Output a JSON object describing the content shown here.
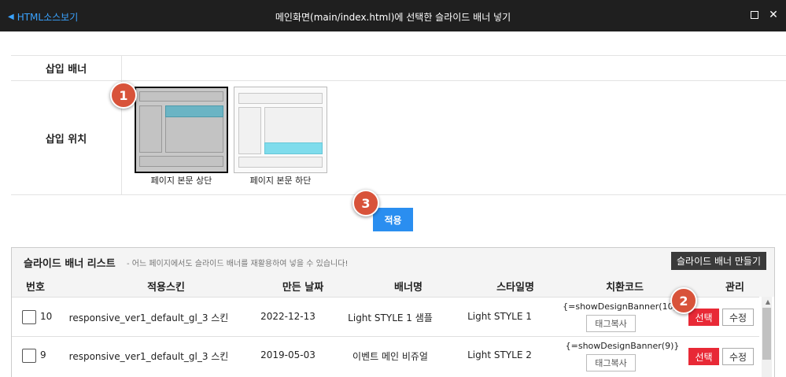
{
  "window": {
    "back_label": "HTML소스보기",
    "title": "메인화면(main/index.html)에 선택한 슬라이드 배너 넣기"
  },
  "options": {
    "banner_label": "삽입 배너",
    "position_label": "삽입 위치",
    "positions": [
      {
        "caption": "페이지 본문 상단",
        "selected": true
      },
      {
        "caption": "페이지 본문 하단",
        "selected": false
      }
    ]
  },
  "badges": [
    "1",
    "2",
    "3"
  ],
  "apply_label": "적용",
  "list": {
    "title": "슬라이드 배너 리스트",
    "description": "- 어느 페이지에서도 슬라이드 배너를 재활용하여 넣을 수 있습니다!",
    "make_button": "슬라이드 배너 만들기",
    "columns": [
      "번호",
      "적용스킨",
      "만든 날짜",
      "배너명",
      "스타일명",
      "치환코드",
      "관리"
    ],
    "rows": [
      {
        "no": "10",
        "skin": "responsive_ver1_default_gl_3 스킨",
        "date": "2022-12-13",
        "name": "Light STYLE 1 샘플",
        "style": "Light STYLE 1",
        "code": "{=showDesignBanner(10)}",
        "copy_label": "태그복사",
        "select_label": "선택",
        "edit_label": "수정"
      },
      {
        "no": "9",
        "skin": "responsive_ver1_default_gl_3 스킨",
        "date": "2019-05-03",
        "name": "이벤트 메인 비쥬얼",
        "style": "Light STYLE 2",
        "code": "{=showDesignBanner(9)}",
        "copy_label": "태그복사",
        "select_label": "선택",
        "edit_label": "수정"
      }
    ]
  },
  "colors": {
    "titlebar": "#1f1f1f",
    "link": "#3aa3ff",
    "apply": "#2a8ef0",
    "select": "#e82936",
    "badge": "#d8533a",
    "highlight": "#6bb4c4"
  }
}
